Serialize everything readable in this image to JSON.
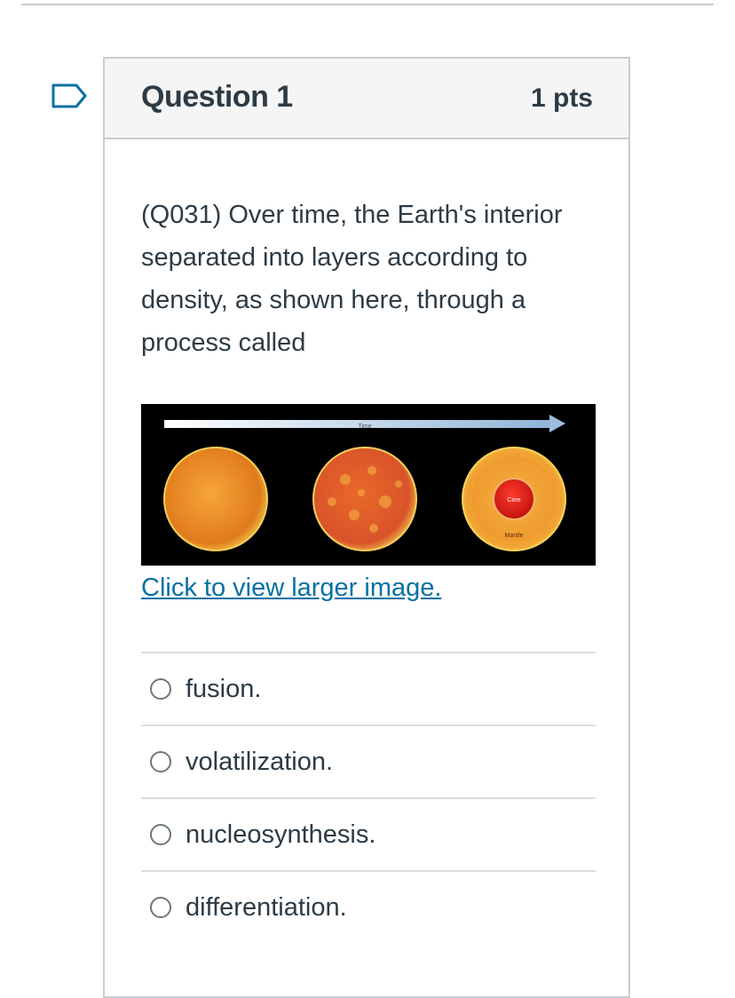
{
  "question": {
    "title": "Question 1",
    "points": "1 pts",
    "text": "(Q031) Over time, the Earth's interior separated into layers according to density, as shown here, through a process called",
    "figure": {
      "arrow_label": "Time",
      "core_label": "Core",
      "mantle_label": "Mantle"
    },
    "larger_image_link": "Click to view larger image.",
    "answers": [
      {
        "label": "fusion."
      },
      {
        "label": "volatilization."
      },
      {
        "label": "nucleosynthesis."
      },
      {
        "label": "differentiation."
      }
    ]
  },
  "colors": {
    "text": "#2d3b45",
    "link": "#0770a3",
    "border": "#c7cdd1",
    "flag": "#0770a3"
  }
}
